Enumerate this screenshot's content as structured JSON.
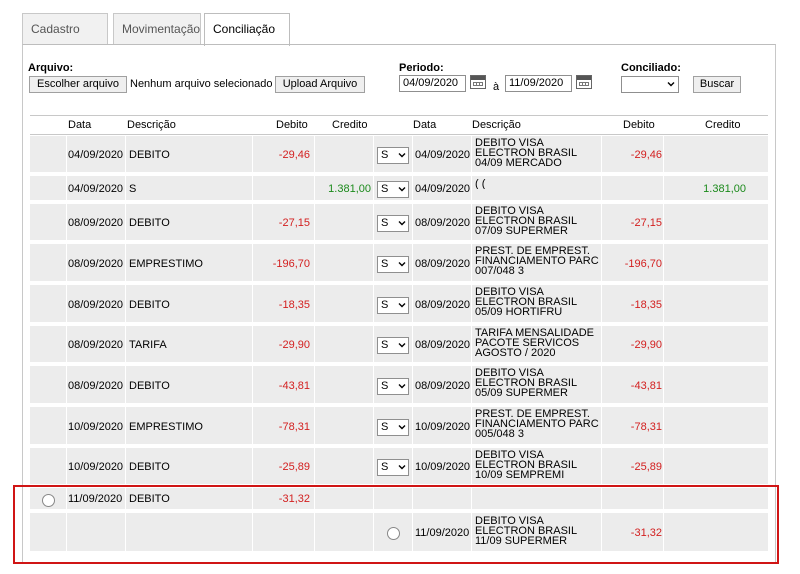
{
  "tabs": [
    {
      "label": "Cadastro",
      "active": false
    },
    {
      "label": "Movimentação",
      "active": false
    },
    {
      "label": "Conciliação",
      "active": true
    }
  ],
  "form": {
    "arquivo_label": "Arquivo:",
    "choose_file_label": "Escolher arquivo",
    "no_file_text": "Nenhum arquivo selecionado",
    "upload_label": "Upload Arquivo",
    "periodo_label": "Periodo:",
    "date_from": "04/09/2020",
    "date_sep": "à",
    "date_to": "11/09/2020",
    "conciliado_label": "Conciliado:",
    "conciliado_value": "",
    "buscar_label": "Buscar"
  },
  "table": {
    "headers": [
      "Data",
      "Descrição",
      "Debito",
      "Credito",
      "Data",
      "Descrição",
      "Debito",
      "Credito"
    ],
    "rows": [
      {
        "date": "04/09/2020",
        "desc": "DEBITO",
        "debit": "-29,46",
        "credit": "",
        "select": "S",
        "date2": "04/09/2020",
        "desc2": "DEBITO VISA ELECTRON BRASIL 04/09 MERCADO",
        "debit2": "-29,46",
        "credit2": ""
      },
      {
        "date": "04/09/2020",
        "desc": "S",
        "debit": "",
        "credit": "1.381,00",
        "select": "S",
        "date2": "04/09/2020",
        "desc2": "( (",
        "debit2": "",
        "credit2": "1.381,00"
      },
      {
        "date": "08/09/2020",
        "desc": "DEBITO",
        "debit": "-27,15",
        "credit": "",
        "select": "S",
        "date2": "08/09/2020",
        "desc2": "DEBITO VISA ELECTRON BRASIL 07/09 SUPERMER",
        "debit2": "-27,15",
        "credit2": ""
      },
      {
        "date": "08/09/2020",
        "desc": "EMPRESTIMO",
        "debit": "-196,70",
        "credit": "",
        "select": "S",
        "date2": "08/09/2020",
        "desc2": "PREST. DE EMPREST. FINANCIAMENTO PARC 007/048 3",
        "debit2": "-196,70",
        "credit2": ""
      },
      {
        "date": "08/09/2020",
        "desc": "DEBITO",
        "debit": "-18,35",
        "credit": "",
        "select": "S",
        "date2": "08/09/2020",
        "desc2": "DEBITO VISA ELECTRON BRASIL 05/09 HORTIFRU",
        "debit2": "-18,35",
        "credit2": ""
      },
      {
        "date": "08/09/2020",
        "desc": "TARIFA",
        "debit": "-29,90",
        "credit": "",
        "select": "S",
        "date2": "08/09/2020",
        "desc2": "TARIFA MENSALIDADE PACOTE SERVICOS AGOSTO / 2020",
        "debit2": "-29,90",
        "credit2": ""
      },
      {
        "date": "08/09/2020",
        "desc": "DEBITO",
        "debit": "-43,81",
        "credit": "",
        "select": "S",
        "date2": "08/09/2020",
        "desc2": "DEBITO VISA ELECTRON BRASIL 05/09 SUPERMER",
        "debit2": "-43,81",
        "credit2": ""
      },
      {
        "date": "10/09/2020",
        "desc": "EMPRESTIMO",
        "debit": "-78,31",
        "credit": "",
        "select": "S",
        "date2": "10/09/2020",
        "desc2": "PREST. DE EMPREST. FINANCIAMENTO PARC 005/048 3",
        "debit2": "-78,31",
        "credit2": ""
      },
      {
        "date": "10/09/2020",
        "desc": "DEBITO",
        "debit": "-25,89",
        "credit": "",
        "select": "S",
        "date2": "10/09/2020",
        "desc2": "DEBITO VISA ELECTRON BRASIL 10/09 SEMPREMI",
        "debit2": "-25,89",
        "credit2": ""
      }
    ],
    "unmatched_left": {
      "date": "11/09/2020",
      "desc": "DEBITO",
      "debit": "-31,32"
    },
    "unmatched_right": {
      "date": "11/09/2020",
      "desc": "DEBITO VISA ELECTRON BRASIL 11/09 SUPERMER",
      "debit": "-31,32"
    }
  },
  "colors": {
    "negative": "#d32020",
    "positive": "#1b8a1b",
    "highlight": "#d01515"
  }
}
